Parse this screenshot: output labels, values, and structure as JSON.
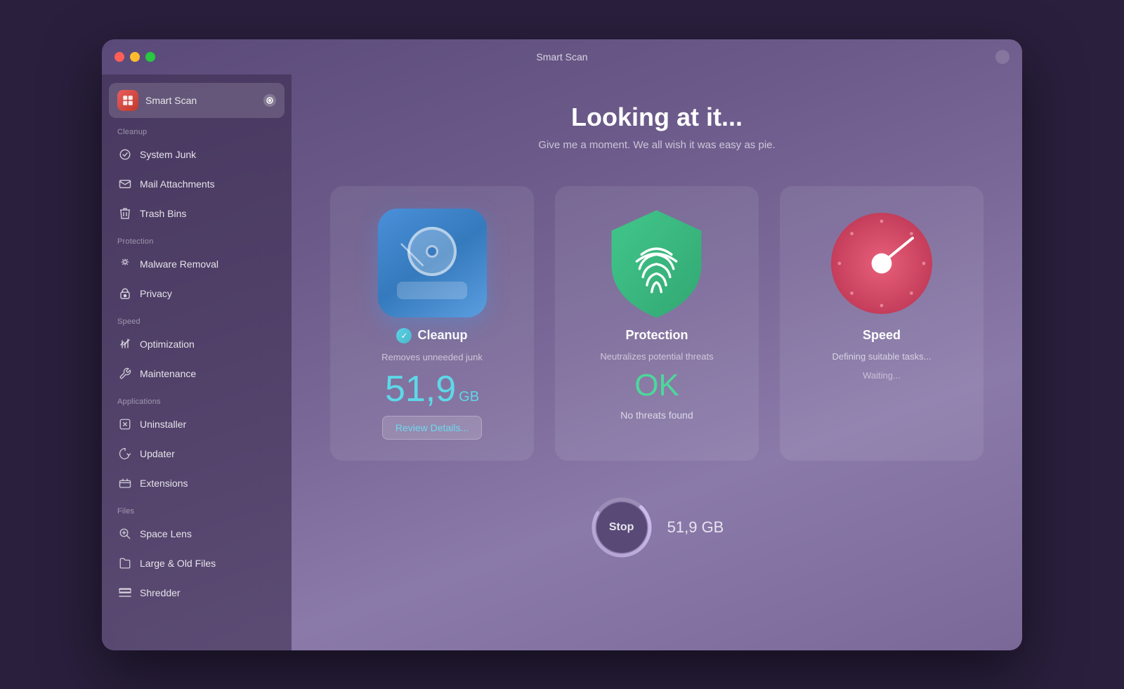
{
  "window": {
    "title": "Smart Scan"
  },
  "sidebar": {
    "active_item": "Smart Scan",
    "smart_scan_label": "Smart Scan",
    "sections": [
      {
        "name": "cleanup_section",
        "label": "Cleanup",
        "items": [
          {
            "id": "system-junk",
            "label": "System Junk",
            "icon": "⚙"
          },
          {
            "id": "mail-attachments",
            "label": "Mail Attachments",
            "icon": "✉"
          },
          {
            "id": "trash-bins",
            "label": "Trash Bins",
            "icon": "🗑"
          }
        ]
      },
      {
        "name": "protection_section",
        "label": "Protection",
        "items": [
          {
            "id": "malware-removal",
            "label": "Malware Removal",
            "icon": "☣"
          },
          {
            "id": "privacy",
            "label": "Privacy",
            "icon": "🤚"
          }
        ]
      },
      {
        "name": "speed_section",
        "label": "Speed",
        "items": [
          {
            "id": "optimization",
            "label": "Optimization",
            "icon": "⇅"
          },
          {
            "id": "maintenance",
            "label": "Maintenance",
            "icon": "🔧"
          }
        ]
      },
      {
        "name": "applications_section",
        "label": "Applications",
        "items": [
          {
            "id": "uninstaller",
            "label": "Uninstaller",
            "icon": "⊠"
          },
          {
            "id": "updater",
            "label": "Updater",
            "icon": "↻"
          },
          {
            "id": "extensions",
            "label": "Extensions",
            "icon": "⇥"
          }
        ]
      },
      {
        "name": "files_section",
        "label": "Files",
        "items": [
          {
            "id": "space-lens",
            "label": "Space Lens",
            "icon": "◎"
          },
          {
            "id": "large-old-files",
            "label": "Large & Old Files",
            "icon": "📁"
          },
          {
            "id": "shredder",
            "label": "Shredder",
            "icon": "≡"
          }
        ]
      }
    ]
  },
  "main": {
    "title": "Looking at it...",
    "subtitle": "Give me a moment. We all wish it was easy as pie.",
    "cards": [
      {
        "id": "cleanup",
        "title": "Cleanup",
        "check_icon": "✓",
        "subtitle": "Removes unneeded junk",
        "value": "51,9",
        "value_unit": "GB",
        "action_label": "Review Details..."
      },
      {
        "id": "protection",
        "title": "Protection",
        "subtitle": "Neutralizes potential threats",
        "status_value": "OK",
        "status_label": "No threats found"
      },
      {
        "id": "speed",
        "title": "Speed",
        "subtitle": "Defining suitable tasks...",
        "waiting_label": "Waiting..."
      }
    ],
    "stop_button_label": "Stop",
    "stop_value": "51,9 GB"
  }
}
